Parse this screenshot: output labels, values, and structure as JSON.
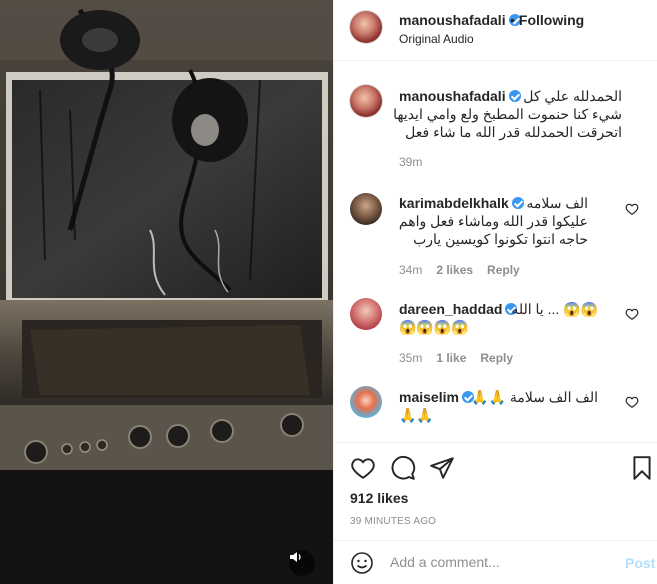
{
  "media": {
    "description_icon": "speaker-icon"
  },
  "header": {
    "username": "manoushafadali",
    "separator": "•",
    "follow_status": "Following",
    "audio": "Original Audio"
  },
  "caption": {
    "username": "manoushafadali",
    "lines": [
      "الحمدلله علي كل",
      "شيء كنا حنموت المطبخ ولع وامي ايديها",
      "اتحرقت الحمدلله قدر الله ما شاء فعل"
    ],
    "age": "39m"
  },
  "comments": [
    {
      "username": "karimabdelkhalk",
      "lines": [
        "الف سلامه",
        "عليكوا قدر الله وماشاء فعل واهم",
        "حاجه انتوا تكونوا كويسين يارب"
      ],
      "age": "34m",
      "likes": "2 likes",
      "reply": "Reply"
    },
    {
      "username": "dareen_haddad",
      "lines": [
        "😱😱 ... يا الله",
        "😱😱😱😱"
      ],
      "age": "35m",
      "likes": "1 like",
      "reply": "Reply"
    },
    {
      "username": "maiselim",
      "lines": [
        "الف الف سلامة 🙏🙏",
        "🙏🙏"
      ]
    }
  ],
  "actions": {
    "likes": "912 likes",
    "timestamp": "39 MINUTES AGO"
  },
  "add_comment": {
    "placeholder": "Add a comment...",
    "post": "Post"
  },
  "colors": {
    "verified": "#3897f0",
    "muted": "#8e8e8e",
    "post_disabled": "#b2dffc"
  }
}
